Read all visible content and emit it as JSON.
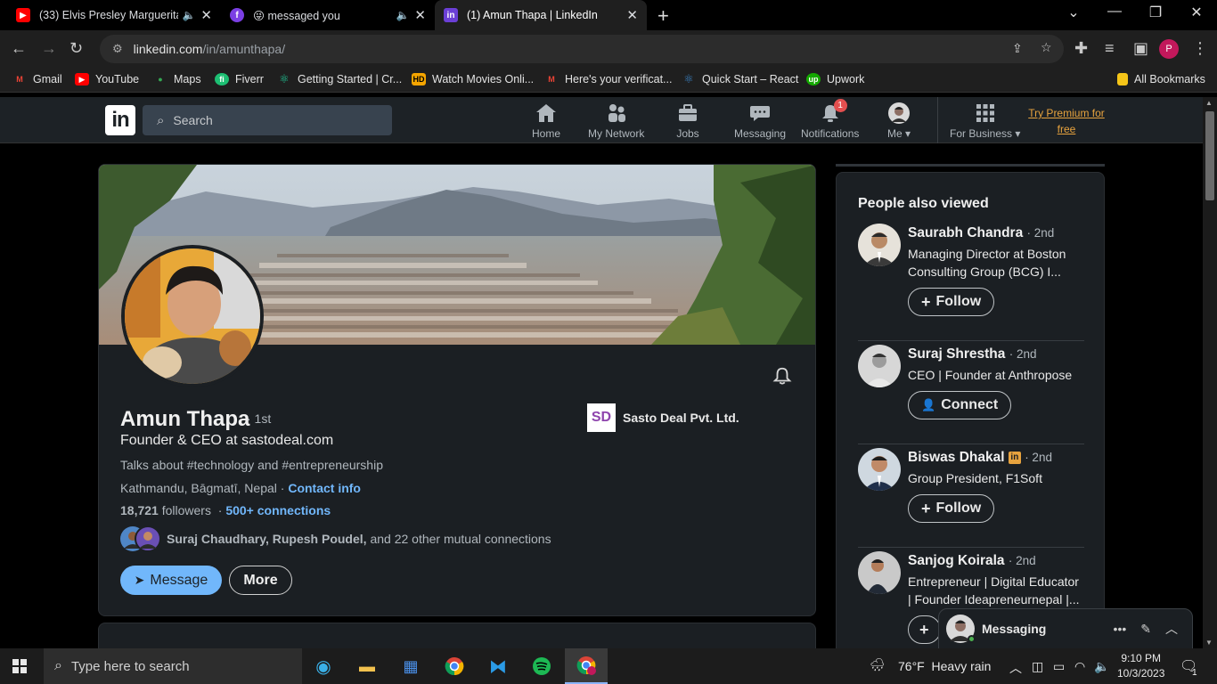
{
  "browser": {
    "tabs": [
      {
        "title": "(33) Elvis Presley Marguerita",
        "favicon": "youtube-icon"
      },
      {
        "title": "messaged you",
        "favicon": "facebook-icon",
        "prefix": "😜"
      },
      {
        "title": "(1) Amun Thapa | LinkedIn",
        "favicon": "linkedin-icon"
      }
    ],
    "url_host": "linkedin.com",
    "url_path": "/in/amunthapa/",
    "profile_initial": "P",
    "bookmarks": [
      {
        "label": "Gmail",
        "icon": "gmail-icon",
        "color": "#ea4335",
        "glyph": "M"
      },
      {
        "label": "YouTube",
        "icon": "youtube-icon",
        "color": "#ff0000",
        "glyph": "▶"
      },
      {
        "label": "Maps",
        "icon": "maps-icon",
        "color": "#34a853",
        "glyph": "●"
      },
      {
        "label": "Fiverr",
        "icon": "fiverr-icon",
        "color": "#1dbf73",
        "glyph": "fi"
      },
      {
        "label": "Getting Started | Cr...",
        "icon": "react-icon",
        "color": "#20c997",
        "glyph": "⚛"
      },
      {
        "label": "Watch Movies Onli...",
        "icon": "hd-icon",
        "color": "#f5a500",
        "glyph": "HD"
      },
      {
        "label": "Here's your verificat...",
        "icon": "gmail-icon",
        "color": "#ea4335",
        "glyph": "M"
      },
      {
        "label": "Quick Start – React",
        "icon": "react-icon",
        "color": "#3b82c4",
        "glyph": "⚛"
      },
      {
        "label": "Upwork",
        "icon": "upwork-icon",
        "color": "#14a800",
        "glyph": "up"
      }
    ],
    "all_bookmarks": "All Bookmarks"
  },
  "linkedin": {
    "search_placeholder": "Search",
    "nav": [
      {
        "label": "Home",
        "icon": "home-icon",
        "glyph": "⌂"
      },
      {
        "label": "My Network",
        "icon": "network-icon",
        "glyph": "👥"
      },
      {
        "label": "Jobs",
        "icon": "briefcase-icon",
        "glyph": "💼"
      },
      {
        "label": "Messaging",
        "icon": "messaging-icon",
        "glyph": "💬"
      },
      {
        "label": "Notifications",
        "icon": "bell-icon",
        "glyph": "🔔",
        "badge": "1"
      },
      {
        "label": "Me",
        "icon": "avatar"
      },
      {
        "label": "For Business",
        "icon": "grid-icon",
        "glyph": "⋮⋮⋮"
      }
    ],
    "premium": "Try Premium for free"
  },
  "profile": {
    "name": "Amun Thapa",
    "degree": "· 1st",
    "headline": "Founder & CEO at sastodeal.com",
    "talks_about": "Talks about #technology and #entrepreneurship",
    "location": "Kathmandu, Bāgmatī, Nepal ·",
    "contact_info": "Contact info",
    "followers_count": "18,721",
    "followers_label": "followers",
    "connections": "500+ connections",
    "mutual_names": "Suraj Chaudhary, Rupesh Poudel,",
    "mutual_rest": "and 22 other mutual connections",
    "company_logo_text": "SD",
    "company": "Sasto Deal Pvt. Ltd.",
    "message_btn": "Message",
    "more_btn": "More"
  },
  "people_also_viewed": {
    "title": "People also viewed",
    "people": [
      {
        "name": "Saurabh Chandra",
        "degree": "· 2nd",
        "title": "Managing Director at Boston Consulting Group (BCG) I...",
        "action": "Follow",
        "action_icon": "+"
      },
      {
        "name": "Suraj Shrestha",
        "degree": "· 2nd",
        "title": "CEO | Founder at Anthropose",
        "action": "Connect",
        "action_icon": "👤+"
      },
      {
        "name": "Biswas Dhakal",
        "degree": "· 2nd",
        "title": "Group President, F1Soft",
        "action": "Follow",
        "action_icon": "+",
        "in_badge": "in"
      },
      {
        "name": "Sanjog Koirala",
        "degree": "· 2nd",
        "title": "Entrepreneur | Digital Educator | Founder Ideapreneurnepal |...",
        "action": "",
        "action_icon": "+"
      }
    ]
  },
  "messaging_widget": {
    "label": "Messaging"
  },
  "taskbar": {
    "search_placeholder": "Type here to search",
    "weather_temp": "76°F",
    "weather_desc": "Heavy rain",
    "time": "9:10 PM",
    "date": "10/3/2023",
    "notif_count": "1"
  }
}
